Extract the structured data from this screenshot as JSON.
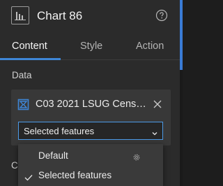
{
  "header": {
    "title": "Chart 86",
    "chart_icon": "bar-chart-icon",
    "help_icon": "help-icon"
  },
  "tabs": [
    {
      "label": "Content",
      "active": true
    },
    {
      "label": "Style",
      "active": false
    },
    {
      "label": "Action",
      "active": false
    }
  ],
  "data_section": {
    "label": "Data",
    "source_name": "C03 2021 LSUG Cens…",
    "source_icon": "dataset-icon",
    "remove_icon": "close-icon",
    "view_select": {
      "value": "Selected features",
      "options": [
        {
          "label": "Default",
          "icon": "gear-icon",
          "selected": false
        },
        {
          "label": "Selected features",
          "selected": true
        }
      ]
    }
  },
  "next_section_partial_label": "C",
  "colors": {
    "accent": "#3e86d6",
    "panel_bg": "#2b2b2b",
    "card_bg": "#383838"
  }
}
